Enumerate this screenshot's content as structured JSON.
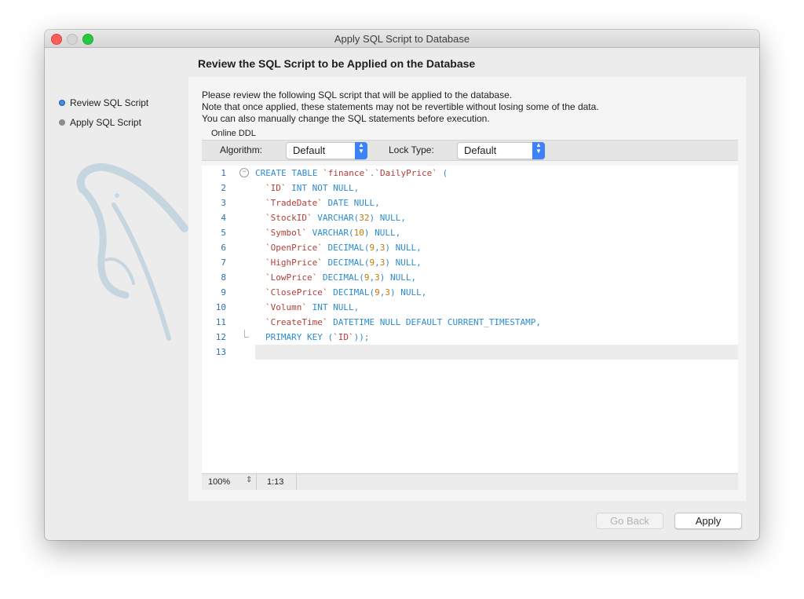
{
  "window": {
    "title": "Apply SQL Script to Database"
  },
  "steps": [
    {
      "label": "Review SQL Script",
      "active": true
    },
    {
      "label": "Apply SQL Script",
      "active": false
    }
  ],
  "header": {
    "title": "Review the SQL Script to be Applied on the Database"
  },
  "intro": {
    "line1": "Please review the following SQL script that will be applied to the database.",
    "line2": "Note that once applied, these statements may not be revertible without losing some of the data.",
    "line3": "You can also manually change the SQL statements before execution."
  },
  "online_ddl": {
    "label": "Online DDL",
    "algorithm_label": "Algorithm:",
    "algorithm_value": "Default",
    "lock_type_label": "Lock Type:",
    "lock_type_value": "Default"
  },
  "editor": {
    "lines": [
      {
        "n": "1",
        "text": "CREATE TABLE `finance`.`DailyPrice` ("
      },
      {
        "n": "2",
        "text": "`ID` INT NOT NULL,"
      },
      {
        "n": "3",
        "text": "`TradeDate` DATE NULL,"
      },
      {
        "n": "4",
        "text": "`StockID` VARCHAR(32) NULL,"
      },
      {
        "n": "5",
        "text": "`Symbol` VARCHAR(10) NULL,"
      },
      {
        "n": "6",
        "text": "`OpenPrice` DECIMAL(9,3) NULL,"
      },
      {
        "n": "7",
        "text": "`HighPrice` DECIMAL(9,3) NULL,"
      },
      {
        "n": "8",
        "text": "`LowPrice` DECIMAL(9,3) NULL,"
      },
      {
        "n": "9",
        "text": "`ClosePrice` DECIMAL(9,3) NULL,"
      },
      {
        "n": "10",
        "text": "`Volumn` INT NULL,"
      },
      {
        "n": "11",
        "text": "`CreateTime` DATETIME NULL DEFAULT CURRENT_TIMESTAMP,"
      },
      {
        "n": "12",
        "text": "PRIMARY KEY (`ID`));"
      },
      {
        "n": "13",
        "text": ""
      }
    ]
  },
  "status_bar": {
    "zoom": "100%",
    "position": "1:13"
  },
  "buttons": {
    "go_back": "Go Back",
    "apply": "Apply"
  },
  "colors": {
    "keyword": "#2c8ccf",
    "identifier": "#b33e38",
    "number": "#c47a0a",
    "accent": "#3d83f7"
  }
}
